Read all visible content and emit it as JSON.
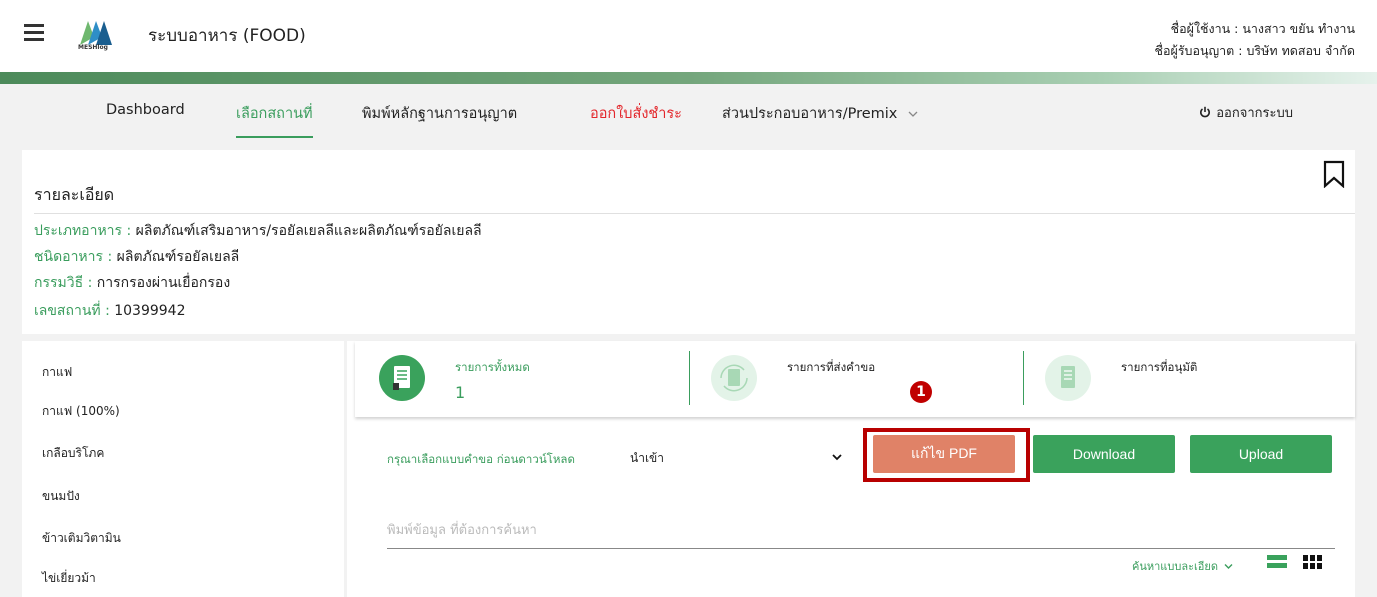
{
  "header": {
    "app_title": "ระบบอาหาร (FOOD)",
    "logo_text": "MESHlog",
    "user_name": "ชื่อผู้ใช้งาน : นางสาว ขยัน ทำงาน",
    "licensee": "ชื่อผู้รับอนุญาต : บริษัท ทดสอบ จำกัด"
  },
  "nav": {
    "items": [
      {
        "label": "Dashboard"
      },
      {
        "label": "เลือกสถานที่"
      },
      {
        "label": "พิมพ์หลักฐานการอนุญาต"
      },
      {
        "label": "ออกใบสั่งชำระ"
      },
      {
        "label": "ส่วนประกอบอาหาร/Premix"
      }
    ],
    "logout": "ออกจากระบบ",
    "active_color": "#3a9d5d",
    "alert_color": "#e3262b"
  },
  "detail": {
    "title": "รายละเอียด",
    "rows": [
      {
        "key": "ประเภทอาหาร : ",
        "value": "ผลิตภัณฑ์เสริมอาหาร/รอยัลเยลลีและผลิตภัณฑ์รอยัลเยลลี"
      },
      {
        "key": "ชนิดอาหาร : ",
        "value": "ผลิตภัณฑ์รอยัลเยลลี"
      },
      {
        "key": "กรรมวิธี : ",
        "value": "การกรองผ่านเยื่อกรอง"
      },
      {
        "key": "เลขสถานที่ : ",
        "value": "10399942"
      }
    ]
  },
  "sidebar": {
    "items": [
      {
        "label": "กาแฟ"
      },
      {
        "label": "กาแฟ (100%)"
      },
      {
        "label": "เกลือบริโภค"
      },
      {
        "label": "ขนมปัง"
      },
      {
        "label": "ข้าวเติมวิตามิน"
      },
      {
        "label": "ไข่เยี่ยวม้า"
      }
    ]
  },
  "stats": [
    {
      "label": "รายการทั้งหมด",
      "count": "1",
      "icon": "document-icon"
    },
    {
      "label": "รายการที่ส่งคำขอ",
      "count": "",
      "icon": "document-refresh-icon"
    },
    {
      "label": "รายการที่อนุมัติ",
      "count": "",
      "icon": "document-icon"
    }
  ],
  "annotation": {
    "marker": "1"
  },
  "form": {
    "select_label": "กรุณาเลือกแบบคำขอ ก่อนดาวน์โหลด",
    "select_value": "นำเข้า",
    "edit_pdf": "แก้ไข PDF",
    "download": "Download",
    "upload": "Upload",
    "search_placeholder": "พิมพ์ข้อมูล ที่ต้องการค้นหา",
    "advanced_search": "ค้นหาแบบละเอียด"
  },
  "colors": {
    "primary_green": "#3aa25c",
    "edit_button": "#e08267",
    "highlight": "#b80000"
  }
}
